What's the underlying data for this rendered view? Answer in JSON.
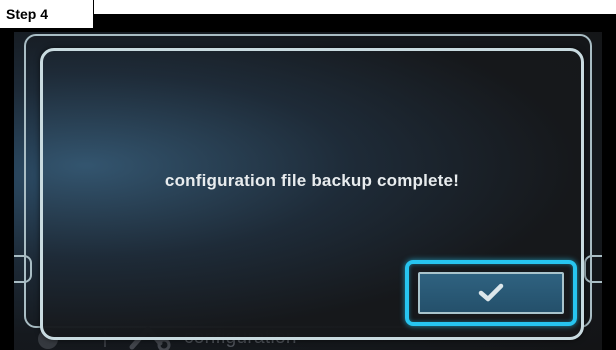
{
  "step_label": "Step 4",
  "background": {
    "footer_label": "configuration",
    "footer_icon": "wrench-screwdriver-icon"
  },
  "dialog": {
    "message": "configuration file backup complete!",
    "confirm_icon": "checkmark-icon"
  },
  "colors": {
    "highlight": "#27c5f0",
    "dialog_border": "#c9dbe0",
    "button_fill": "#2a5a78"
  }
}
